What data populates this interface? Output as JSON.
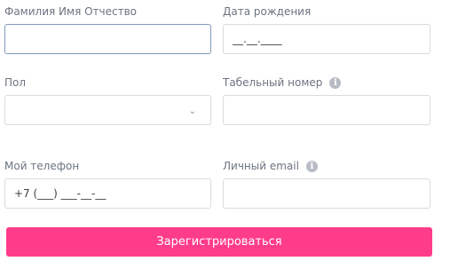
{
  "form": {
    "full_name": {
      "label": "Фамилия Имя Отчество",
      "value": ""
    },
    "birth_date": {
      "label": "Дата рождения",
      "value": "__.__.____"
    },
    "gender": {
      "label": "Пол",
      "value": "",
      "chevron": "⌄"
    },
    "employee_number": {
      "label": "Табельный номер",
      "value": "",
      "info_icon": "i"
    },
    "phone": {
      "label": "Мой телефон",
      "value": "+7 (___) ___-__-__"
    },
    "email": {
      "label": "Личный email",
      "value": "",
      "info_icon": "i"
    },
    "submit_label": "Зарегистрироваться"
  },
  "colors": {
    "accent": "#ff3c8a",
    "border": "#d7dbe0",
    "focus_border": "#7f9bb9",
    "label_text": "#6b7480"
  }
}
